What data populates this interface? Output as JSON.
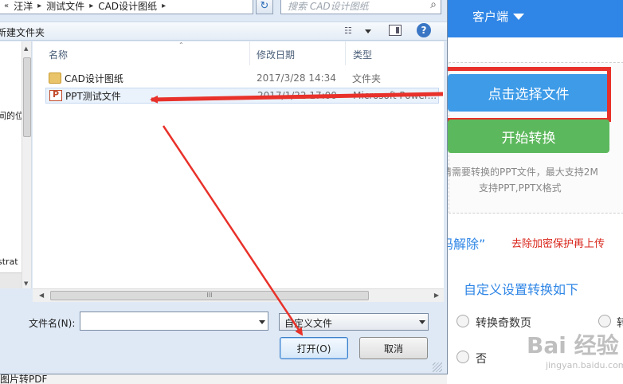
{
  "dialog": {
    "breadcrumb": [
      "汪洋",
      "测试文件",
      "CAD设计图纸"
    ],
    "search_placeholder": "搜索 CAD设计图纸",
    "toolbar": {
      "new_folder": "新建文件夹"
    },
    "nav_pane": {
      "text1": "间的位",
      "text2": "strat"
    },
    "columns": {
      "name": "名称",
      "date": "修改日期",
      "type": "类型"
    },
    "files": [
      {
        "name": "CAD设计图纸",
        "date": "2017/3/28 14:34",
        "type": "文件夹",
        "icon": "folder-icon"
      },
      {
        "name": "PPT测试文件",
        "date": "2017/1/22 17:00",
        "type": "Microsoft Power...",
        "icon": "ppt-file-icon"
      }
    ],
    "filename_label": "文件名(N):",
    "filename_value": "",
    "filetype_value": "自定义文件",
    "open_label": "打开(O)",
    "cancel_label": "取消",
    "scroll_grip": "III"
  },
  "web": {
    "client_menu": "客户端",
    "select_file": "点击选择文件",
    "start_convert": "开始转换",
    "hint_line1": "请需要转换的PPT文件，最大支持2M",
    "hint_line2": "支持PPT,PPTX格式",
    "unlock_link": "码解除”",
    "remove_tip": "去除加密保护再上传",
    "settings_title": "自定义设置转换如下",
    "option1": "转换奇数页",
    "option2": "否",
    "option3": "转",
    "watermark_main": "Bai 经验",
    "watermark_sub": "jingyan.baidu.com"
  },
  "bottom_text": "图片转PDF",
  "colors": {
    "accent_blue": "#2f86e6",
    "highlight_red": "#e8312a",
    "convert_green": "#5cb85c"
  }
}
